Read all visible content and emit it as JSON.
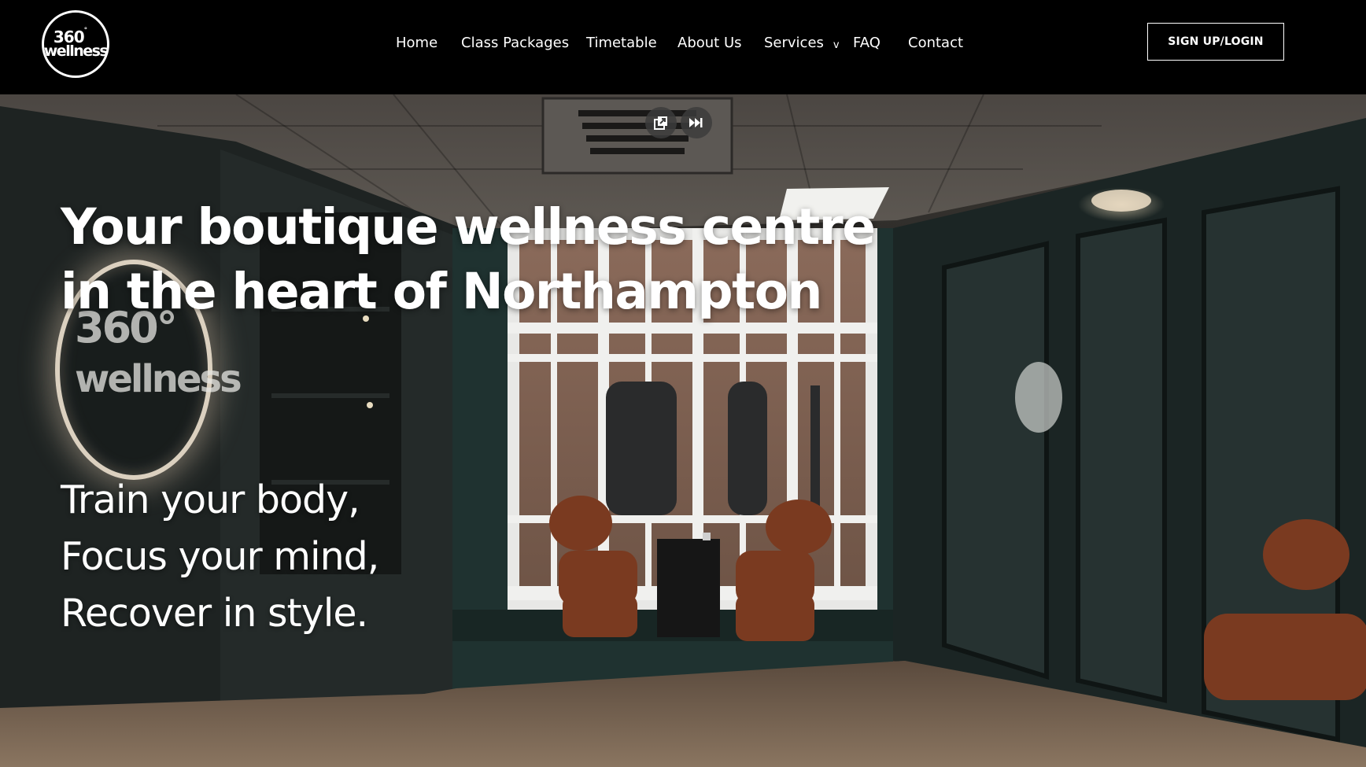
{
  "brand": {
    "logo_line1": "360",
    "logo_degree": "°",
    "logo_line2": "wellness"
  },
  "nav": {
    "items": [
      {
        "label": "Home"
      },
      {
        "label": "Class Packages"
      },
      {
        "label": "Timetable"
      },
      {
        "label": "About Us"
      },
      {
        "label": "Services",
        "dropdown_glyph": "v"
      },
      {
        "label": "FAQ"
      },
      {
        "label": "Contact"
      }
    ],
    "signup_label": "SIGN UP/LOGIN"
  },
  "hero": {
    "headline_line1": "Your boutique wellness centre",
    "headline_line2": "in the heart of Northampton",
    "tagline_line1": "Train your body,",
    "tagline_line2": "Focus your mind,",
    "tagline_line3": "Recover in style.",
    "video_controls": {
      "icon1": "picture-in-picture-icon",
      "icon2": "skip-forward-icon"
    },
    "sign_line1": "360°",
    "sign_line2": "wellness"
  },
  "colors": {
    "header_bg": "#000000",
    "text": "#ffffff",
    "wall_green": "#1f3230",
    "chair_rust": "#7a3a20",
    "floor_wood": "#6e5a48"
  }
}
